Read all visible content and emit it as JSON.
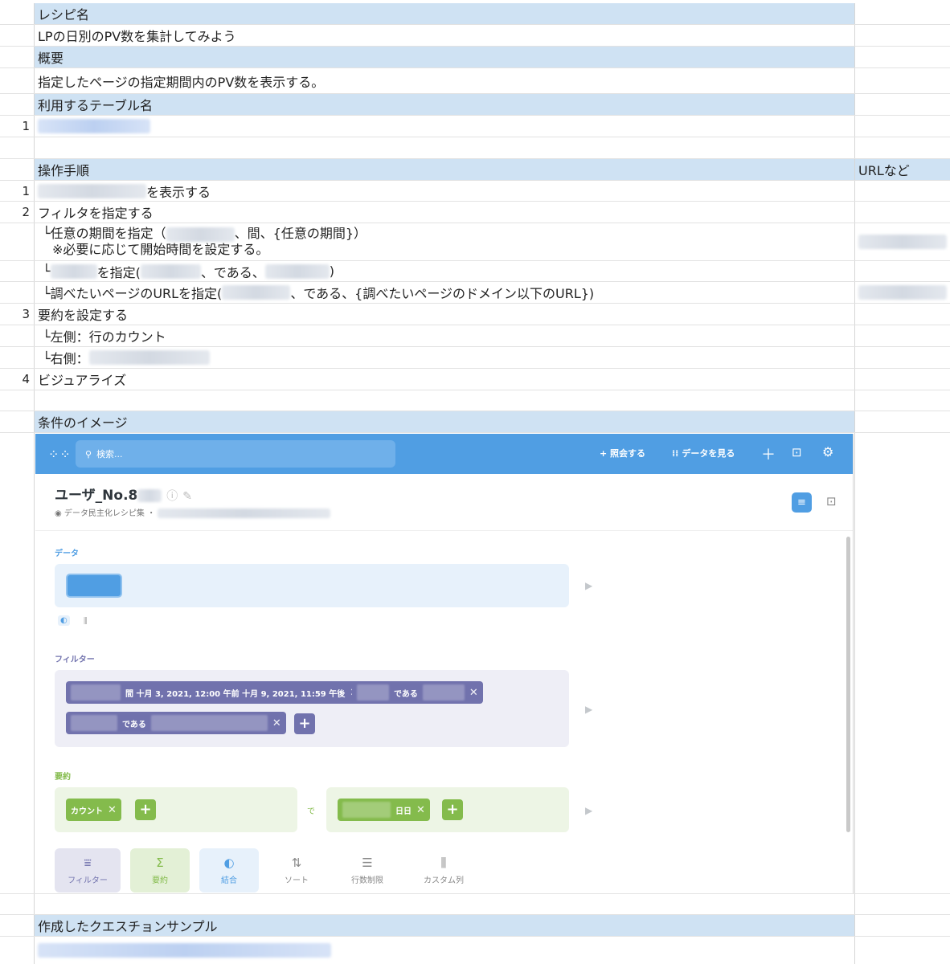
{
  "sheet": {
    "recipe_name_header": "レシピ名",
    "recipe_name": "LPの日別のPV数を集計してみよう",
    "summary_header": "概要",
    "summary": "指定したページの指定期間内のPV数を表示する。",
    "tables_header": "利用するテーブル名",
    "table_row_index": "1",
    "steps_header": "操作手順",
    "url_header": "URLなど",
    "steps": [
      {
        "index": "1",
        "text": "を表示する"
      },
      {
        "index": "2",
        "text": "フィルタを指定する"
      },
      {
        "sub1_a": "└任意の期間を指定（",
        "sub1_b": "、間、{任意の期間}）",
        "sub1_c": "※必要に応じて開始時間を設定する。"
      },
      {
        "sub2_a": "└",
        "sub2_b": "を指定(",
        "sub2_c": "、である、",
        "sub2_d": ")"
      },
      {
        "sub3_a": "└調べたいページのURLを指定(",
        "sub3_b": "、である、{調べたいページのドメイン以下のURL})"
      },
      {
        "index": "3",
        "text": "要約を設定する"
      },
      {
        "sub4": "└左側：行のカウント"
      },
      {
        "sub5": "└右側："
      },
      {
        "index": "4",
        "text": "ビジュアライズ"
      }
    ],
    "image_header": "条件のイメージ",
    "sample_header": "作成したクエスチョンサンプル"
  },
  "app": {
    "search_placeholder": "検索...",
    "join_button": "+ 照会する",
    "browse_button": "データを見る",
    "question_title": "ユーザ_No.8",
    "collection": "データ民主化レシピ集",
    "section_data": "データ",
    "section_filter": "フィルター",
    "section_summarize": "要約",
    "filter_chip1": "間 十月 3, 2021, 12:00 午前 十月 9, 2021, 11:59 午後",
    "filter_chip2": "である",
    "filter_chip3": "である",
    "summary_metric": "カウント",
    "summary_by": "で",
    "summary_group": "日日",
    "actions": [
      "フィルター",
      "要約",
      "結合",
      "ソート",
      "行数制限",
      "カスタム列"
    ]
  },
  "colors": {
    "accent": "#509ee3",
    "filter": "#7172ad",
    "summarize": "#84bb4c",
    "header_fill": "#cfe2f3"
  }
}
